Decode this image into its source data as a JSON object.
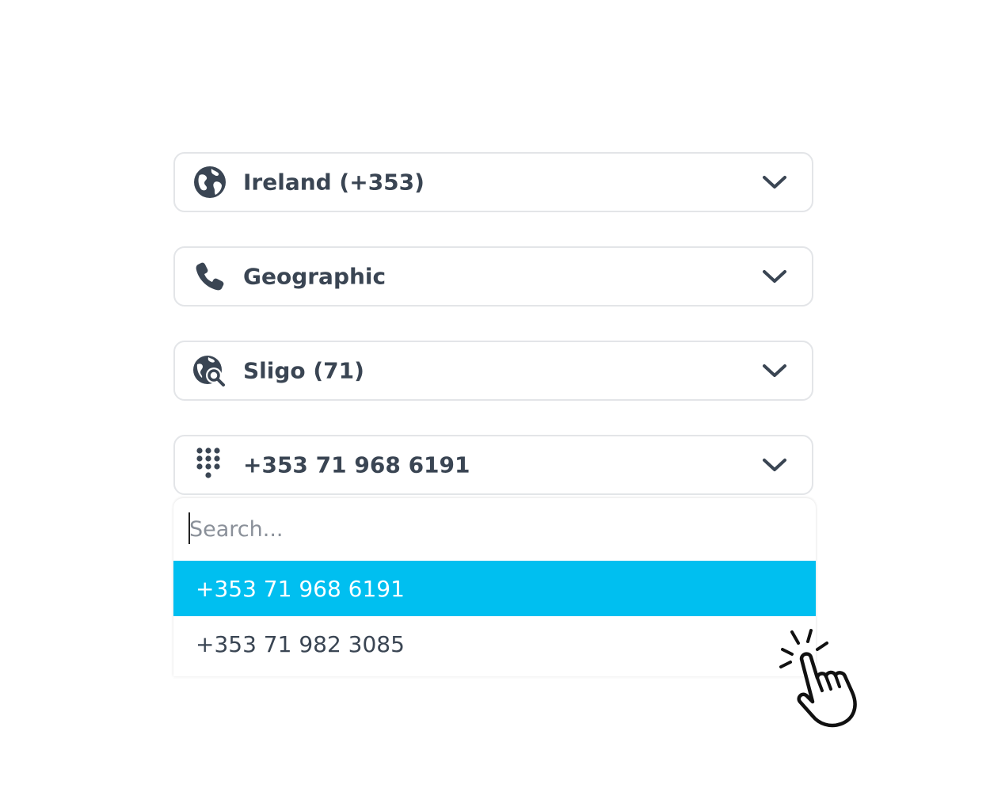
{
  "country_select": {
    "value": "Ireland (+353)",
    "icon": "globe-icon"
  },
  "type_select": {
    "value": "Geographic",
    "icon": "phone-icon"
  },
  "area_select": {
    "value": "Sligo (71)",
    "icon": "location-search-icon"
  },
  "number_select": {
    "value": "+353 71 968 6191",
    "icon": "dialpad-icon"
  },
  "dropdown": {
    "search_placeholder": "Search...",
    "options": [
      {
        "label": "+353 71 968 6191",
        "selected": true
      },
      {
        "label": "+353 71 982 3085",
        "selected": false
      }
    ]
  },
  "colors": {
    "text": "#3a4553",
    "border": "#e3e5e8",
    "highlight": "#00bff0",
    "icon": "#3a4553"
  },
  "pointer_icon": "hand-pointer-icon"
}
